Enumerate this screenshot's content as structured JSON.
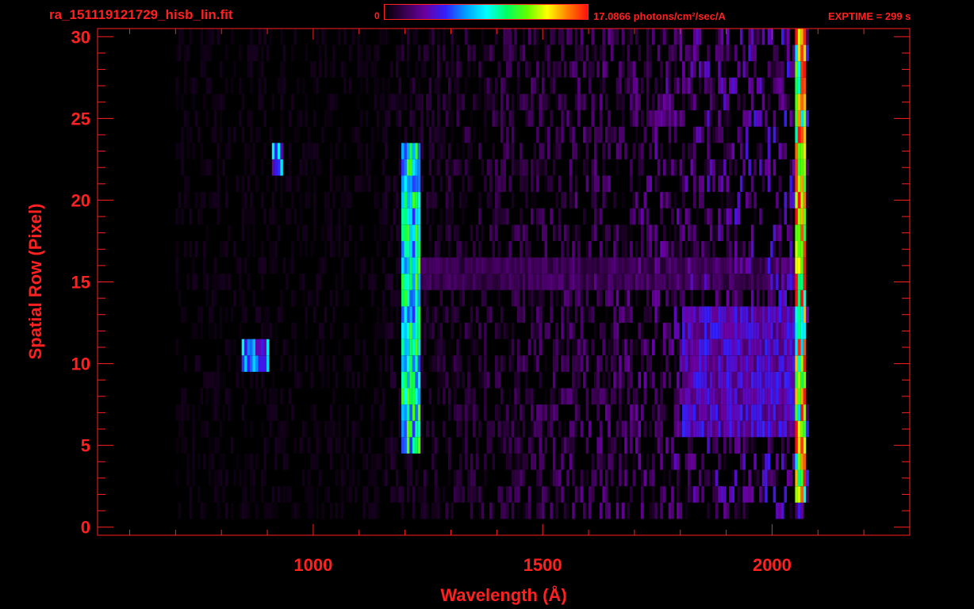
{
  "header": {
    "filename": "ra_151119121729_hisb_lin.fit",
    "colorbar_min_label": "0",
    "colorbar_max_label": "17.0866 photons/cm²/sec/A",
    "exptime_label": "EXPTIME = 299 s"
  },
  "colors": {
    "text": "#ff2020",
    "background": "#000000",
    "colormap": [
      "#000000",
      "#3a0050",
      "#6a00a0",
      "#3020ff",
      "#00a0ff",
      "#00ffff",
      "#00ff60",
      "#60ff00",
      "#ffff00",
      "#ff8000",
      "#ff1010"
    ]
  },
  "chart_data": {
    "type": "heatmap",
    "title": "",
    "xlabel": "Wavelength (Å)",
    "ylabel": "Spatial Row (Pixel)",
    "xlim": [
      530,
      2300
    ],
    "ylim": [
      -0.5,
      30.5
    ],
    "x_ticks": [
      1000,
      1500,
      2000
    ],
    "x_tick_labels": [
      "1000",
      "1500",
      "2000"
    ],
    "y_ticks": [
      0,
      5,
      10,
      15,
      20,
      25,
      30
    ],
    "y_tick_labels": [
      "0",
      "5",
      "10",
      "15",
      "20",
      "25",
      "30"
    ],
    "colorbar_range": [
      0,
      17.0866
    ],
    "colorbar_unit": "photons/cm²/sec/A",
    "rows": 30,
    "features": [
      {
        "x_range": [
          1190,
          1230
        ],
        "row_range": [
          5,
          23
        ],
        "intensity": 0.5
      },
      {
        "x_range": [
          840,
          900
        ],
        "row_range": [
          10,
          11
        ],
        "intensity": 0.35
      },
      {
        "x_range": [
          910,
          930
        ],
        "row_range": [
          22,
          23
        ],
        "intensity": 0.35
      },
      {
        "x_range": [
          1800,
          2060
        ],
        "row_range": [
          6,
          13
        ],
        "intensity": 0.22
      },
      {
        "x_range": [
          2050,
          2070
        ],
        "row_range": [
          2,
          30
        ],
        "intensity": 0.75
      },
      {
        "x_range": [
          1230,
          2050
        ],
        "row_range": [
          15,
          16
        ],
        "intensity": 0.1
      }
    ]
  }
}
